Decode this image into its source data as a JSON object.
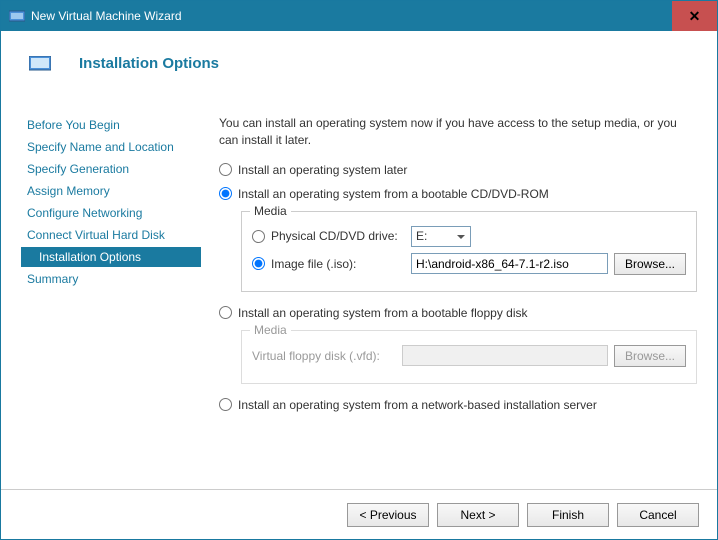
{
  "titlebar": {
    "title": "New Virtual Machine Wizard"
  },
  "header": {
    "title": "Installation Options"
  },
  "sidebar": {
    "items": [
      {
        "label": "Before You Begin"
      },
      {
        "label": "Specify Name and Location"
      },
      {
        "label": "Specify Generation"
      },
      {
        "label": "Assign Memory"
      },
      {
        "label": "Configure Networking"
      },
      {
        "label": "Connect Virtual Hard Disk"
      },
      {
        "label": "Installation Options"
      },
      {
        "label": "Summary"
      }
    ]
  },
  "content": {
    "intro": "You can install an operating system now if you have access to the setup media, or you can install it later.",
    "opt_later": "Install an operating system later",
    "opt_cddvd": "Install an operating system from a bootable CD/DVD-ROM",
    "media_legend": "Media",
    "physical_label": "Physical CD/DVD drive:",
    "physical_drive": "E:",
    "image_label": "Image file (.iso):",
    "image_path": "H:\\android-x86_64-7.1-r2.iso",
    "browse": "Browse...",
    "opt_floppy": "Install an operating system from a bootable floppy disk",
    "floppy_legend": "Media",
    "floppy_label": "Virtual floppy disk (.vfd):",
    "opt_network": "Install an operating system from a network-based installation server"
  },
  "footer": {
    "previous": "< Previous",
    "next": "Next >",
    "finish": "Finish",
    "cancel": "Cancel"
  }
}
